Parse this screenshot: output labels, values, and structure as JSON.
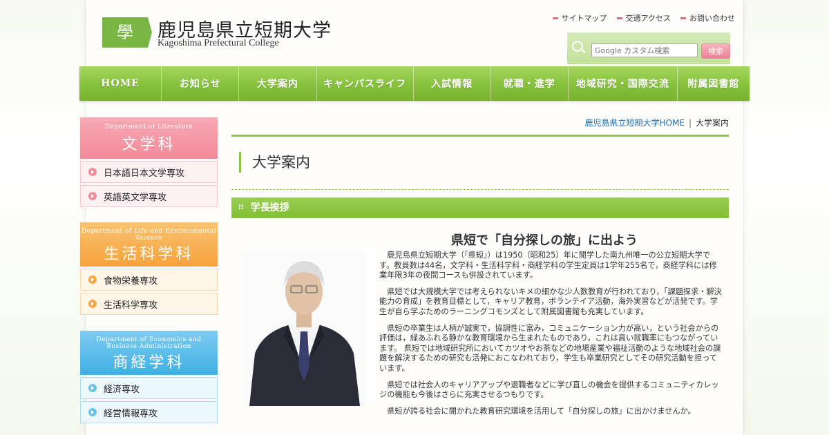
{
  "header": {
    "logo_mark": "學",
    "title_jp": "鹿児島県立短期大学",
    "title_en": "Kagoshima Prefectural College",
    "utility_links": [
      "サイトマップ",
      "交通アクセス",
      "お問い合わせ"
    ]
  },
  "search": {
    "placeholder": "Google カスタム検索",
    "button_label": "検索"
  },
  "nav": {
    "items": [
      "HOME",
      "お知らせ",
      "大学案内",
      "キャンパスライフ",
      "入試情報",
      "就職・進学",
      "地域研究・国際交流",
      "附属図書館"
    ]
  },
  "sidebar": {
    "departments": [
      {
        "en": "Department of Literature",
        "jp": "文学科",
        "majors": [
          "日本語日本文学専攻",
          "英語英文学専攻"
        ]
      },
      {
        "en": "Department of Life and Environmental Science",
        "jp": "生活科学科",
        "majors": [
          "食物栄養専攻",
          "生活科学専攻"
        ]
      },
      {
        "en": "Department of Economics and Business Administration",
        "jp": "商経学科",
        "majors": [
          "経済専攻",
          "経営情報専攻"
        ]
      }
    ]
  },
  "breadcrumb": {
    "home": "鹿児島県立短期大学HOME",
    "separator": "|",
    "current": "大学案内"
  },
  "page_title": "大学案内",
  "section": {
    "heading": "学長挨拶",
    "tick": "⁝⁝"
  },
  "article": {
    "title": "県短で「自分探しの旅」に出よう",
    "paragraphs": [
      "鹿児島県立短期大学（「県短」）は1950（昭和25）年に開学した南九州唯一の公立短期大学です。教員数は44名，文学科・生活科学科・商経学科の学生定員は1学年255名で，商経学科には修業年限3年の夜間コースも併設されています。",
      "県短では大規模大学では考えられないキメの細かな少人数教育が行われており，「課題探求・解決能力の育成」を教育目標として，キャリア教育，ボランテイア活動，海外実習などが活発です。学生が自ら学ぶためのラーニングコモンズとして附属図書館も充実しています。",
      "県短の卒業生は人柄が誠実で，協調性に富み，コミュニケーション力が高い，という社会からの評価は，緑あふれる静かな教育環境から生まれたものであり，これは高い就職率にもつながっています。 県短では地域研究所においてカツオやお茶などの地場産業や福祉活動のような地域社会の課題を解決するための研究も活発におこなわれており，学生も卒業研究としてその研究活動を担っています。",
      "県短では社会人のキャリアアップや退職者などに学び直しの機会を提供するコミュニティカレッジの機能も今後はさらに充実させるつもりです。",
      "県短が誇る社会に開かれた教育研究環境を活用して「自分探しの旅」に出かけませんか。"
    ]
  },
  "colors": {
    "accent_green": "#8cc63f",
    "literature_pink": "#f28a99",
    "life_orange": "#f5a23d",
    "economics_blue": "#3fafe3",
    "link_blue": "#1a6fb5"
  }
}
